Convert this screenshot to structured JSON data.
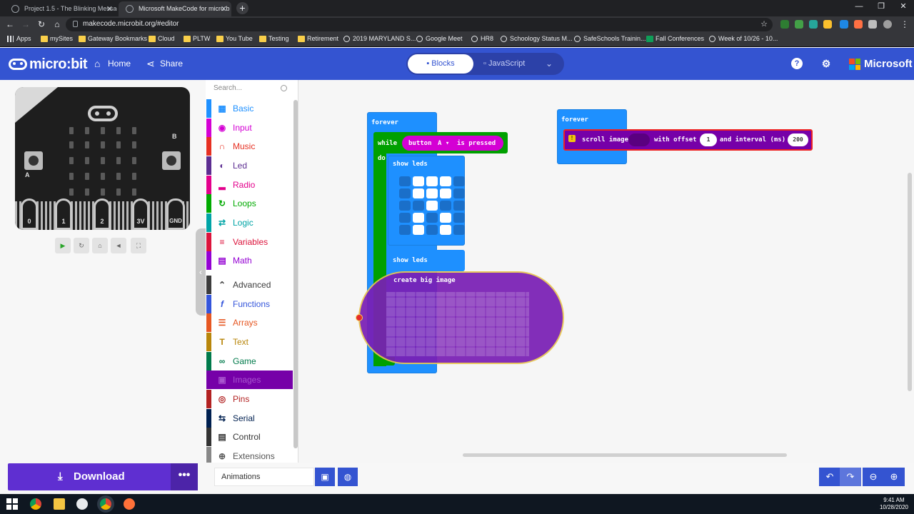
{
  "browser": {
    "tabs": [
      {
        "title": "Project 1.5 - The Blinking Messag",
        "active": false
      },
      {
        "title": "Microsoft MakeCode for micro:b",
        "active": true
      }
    ],
    "url": "makecode.microbit.org/#editor",
    "bookmarks": [
      "Apps",
      "mySites",
      "Gateway Bookmarks",
      "Cloud",
      "PLTW",
      "You Tube",
      "Testing",
      "Retirement",
      "2019 MARYLAND S...",
      "Google Meet",
      "HR8",
      "Schoology Status M...",
      "SafeSchools Trainin...",
      "Fall Conferences",
      "Week of 10/26 - 10..."
    ]
  },
  "header": {
    "logo": "micro:bit",
    "home_label": "Home",
    "share_label": "Share",
    "blocks_label": "Blocks",
    "javascript_label": "JavaScript",
    "brand": "Microsoft",
    "colors": {
      "header_bg": "#3454d1",
      "download_bg": "#5f2fd1"
    }
  },
  "simulator": {
    "pins": [
      "0",
      "1",
      "2",
      "3V",
      "GND"
    ],
    "button_a": "A",
    "button_b": "B"
  },
  "toolbox": {
    "search_placeholder": "Search...",
    "categories": [
      {
        "label": "Basic",
        "color": "#1e90ff",
        "icon": "grid-icon"
      },
      {
        "label": "Input",
        "color": "#d400d4",
        "icon": "target-icon"
      },
      {
        "label": "Music",
        "color": "#e63022",
        "icon": "headphones-icon"
      },
      {
        "label": "Led",
        "color": "#5c2d91",
        "icon": "toggle-icon"
      },
      {
        "label": "Radio",
        "color": "#e3008c",
        "icon": "signal-icon"
      },
      {
        "label": "Loops",
        "color": "#00aa00",
        "icon": "refresh-icon"
      },
      {
        "label": "Logic",
        "color": "#00a4a6",
        "icon": "shuffle-icon"
      },
      {
        "label": "Variables",
        "color": "#dc143c",
        "icon": "list-icon"
      },
      {
        "label": "Math",
        "color": "#9400d3",
        "icon": "calculator-icon"
      },
      {
        "label": "Advanced",
        "color": "#3c3c3c",
        "icon": "chevron-up-icon"
      },
      {
        "label": "Functions",
        "color": "#3455db",
        "icon": "function-icon"
      },
      {
        "label": "Arrays",
        "color": "#e65722",
        "icon": "lines-icon"
      },
      {
        "label": "Text",
        "color": "#b8860b",
        "icon": "text-icon"
      },
      {
        "label": "Game",
        "color": "#007a4b",
        "icon": "gamepad-icon"
      },
      {
        "label": "Images",
        "color": "#7600a8",
        "icon": "image-icon"
      },
      {
        "label": "Pins",
        "color": "#b22222",
        "icon": "pin-icon"
      },
      {
        "label": "Serial",
        "color": "#002050",
        "icon": "usb-icon"
      },
      {
        "label": "Control",
        "color": "#333333",
        "icon": "control-icon"
      },
      {
        "label": "Extensions",
        "color": "#888888",
        "icon": "plus-circle-icon"
      }
    ]
  },
  "workspace": {
    "block1": {
      "forever": "forever",
      "while": "while",
      "do": "do",
      "button": "button",
      "button_value": "A",
      "pressed": "is pressed",
      "show_leds_1": "show leds",
      "show_leds_2": "show leds",
      "leds": [
        0,
        1,
        1,
        1,
        0,
        0,
        1,
        1,
        1,
        0,
        0,
        0,
        1,
        0,
        0,
        0,
        1,
        0,
        1,
        0,
        0,
        1,
        0,
        1,
        0
      ]
    },
    "block2": {
      "forever": "forever",
      "scroll_image": "scroll image",
      "with_offset": "with offset",
      "offset_value": "1",
      "and_interval": "and interval (ms)",
      "interval_value": "200"
    },
    "dragging_block": "create big image"
  },
  "bottom": {
    "download_label": "Download",
    "more_label": "•••",
    "project_name": "Animations"
  },
  "taskbar": {
    "time": "9:41 AM",
    "date": "10/28/2020"
  }
}
